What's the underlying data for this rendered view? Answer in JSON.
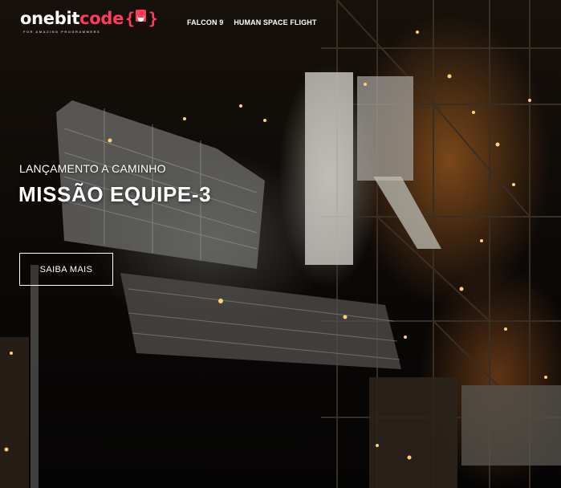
{
  "header": {
    "logo": {
      "text_main": "onebit",
      "text_accent": "code",
      "brace_open": "{",
      "brace_close": "}",
      "tagline": "FOR AMAZING PROGRAMMERS",
      "icon": "devil-icon"
    },
    "nav": [
      {
        "label": "FALCON 9"
      },
      {
        "label": "HUMAN SPACE FLIGHT"
      }
    ]
  },
  "hero": {
    "kicker": "LANÇAMENTO A CAMINHO",
    "headline": "MISSÃO EQUIPE-3",
    "cta_label": "SAIBA MAIS",
    "background": "launch-tower-night-photo"
  },
  "colors": {
    "brand_accent": "#ff3c5c",
    "text": "#ffffff",
    "background": "#0a0806"
  }
}
